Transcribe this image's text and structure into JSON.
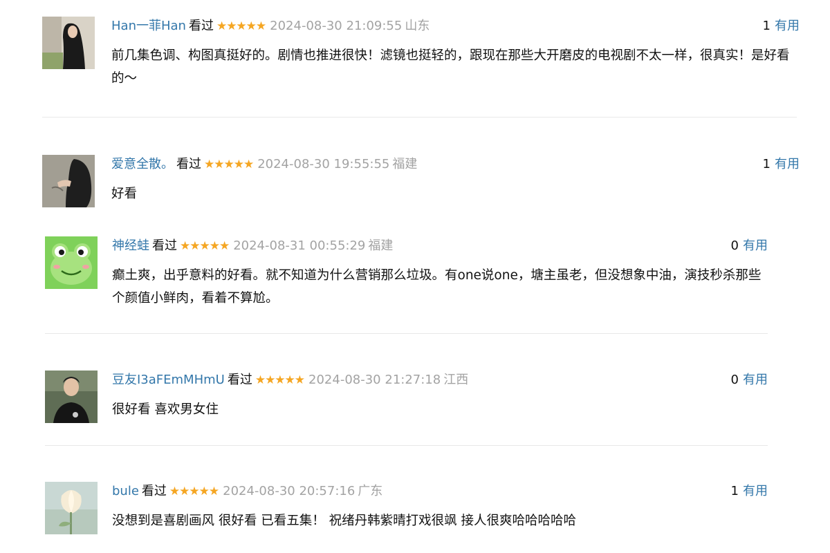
{
  "comments": [
    {
      "user": "Han一菲Han",
      "watched": "看过",
      "stars": "★★★★★",
      "time": "2024-08-30 21:09:55",
      "region": "山东",
      "useful_count": "1",
      "useful_label": "有用",
      "text": "前几集色调、构图真挺好的。剧情也推进很快！滤镜也挺轻的，跟现在那些大开磨皮的电视剧不太一样，很真实！是好看的～",
      "avatar": "woman-long-hair-photo"
    },
    {
      "user": "爱意全散。",
      "watched": "看过",
      "stars": "★★★★★",
      "time": "2024-08-30 19:55:55",
      "region": "福建",
      "useful_count": "1",
      "useful_label": "有用",
      "text": "好看",
      "avatar": "person-touching-wall-photo"
    },
    {
      "user": "神经蛙",
      "watched": "看过",
      "stars": "★★★★★",
      "time": "2024-08-31 00:55:29",
      "region": "福建",
      "useful_count": "0",
      "useful_label": "有用",
      "text": "癫土爽，出乎意料的好看。就不知道为什么营销那么垃圾。有one说one，塘主虽老，但没想象中油，演技秒杀那些个颜值小鲜肉，看着不算尬。",
      "avatar": "cartoon-frog"
    },
    {
      "user": "豆友I3aFEmMHmU",
      "watched": "看过",
      "stars": "★★★★★",
      "time": "2024-08-30 21:27:18",
      "region": "江西",
      "useful_count": "0",
      "useful_label": "有用",
      "text": "很好看 喜欢男女住",
      "avatar": "man-in-black-photo"
    },
    {
      "user": "bule",
      "watched": "看过",
      "stars": "★★★★★",
      "time": "2024-08-30 20:57:16",
      "region": "广东",
      "useful_count": "1",
      "useful_label": "有用",
      "text": "没想到是喜剧画风 很好看 已看五集！ 祝绪丹韩紫晴打戏很飒 接人很爽哈哈哈哈哈",
      "avatar": "tulip-flower-photo"
    }
  ],
  "colors": {
    "link": "#3377aa",
    "star": "#f5a623",
    "muted": "#a3a3a3",
    "divider": "#e8e8e8"
  }
}
